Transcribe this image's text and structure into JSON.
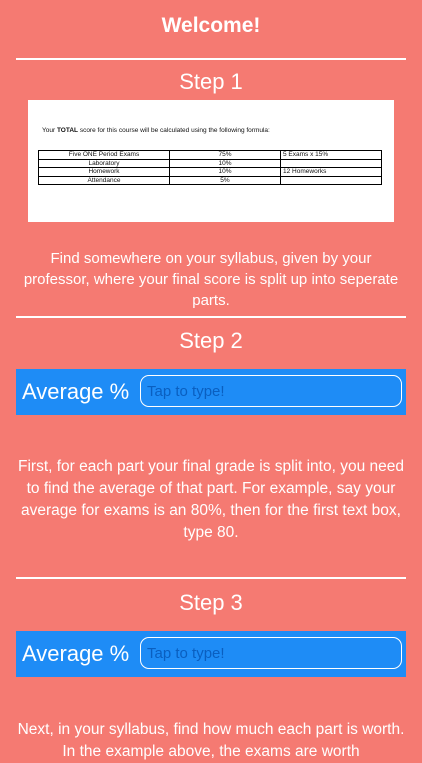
{
  "header": {
    "title": "Welcome!"
  },
  "step1": {
    "heading": "Step 1",
    "sample": {
      "intro_prefix": "Your ",
      "intro_bold": "TOTAL",
      "intro_suffix": " score for this course will be calculated using the following formula:",
      "rows": [
        [
          "Five ONE Period Exams",
          "75%",
          "5 Exams  x 15%"
        ],
        [
          "Laboratory",
          "10%",
          ""
        ],
        [
          "Homework",
          "10%",
          "12 Homeworks"
        ],
        [
          "Attendance",
          "5%",
          ""
        ]
      ]
    },
    "description": "Find somewhere on your syllabus, given by your professor, where your final score is split up into seperate parts."
  },
  "step2": {
    "heading": "Step 2",
    "label": "Average %",
    "placeholder": "Tap to type!",
    "description": "First, for each part your final grade is split into, you need to find the average of that part. For example, say your average for exams is an 80%, then for the first text box, type 80."
  },
  "step3": {
    "heading": "Step 3",
    "label": "Average %",
    "placeholder": "Tap to type!",
    "description": "Next, in your syllabus, find how much each part is worth. In the example above, the exams are worth"
  }
}
